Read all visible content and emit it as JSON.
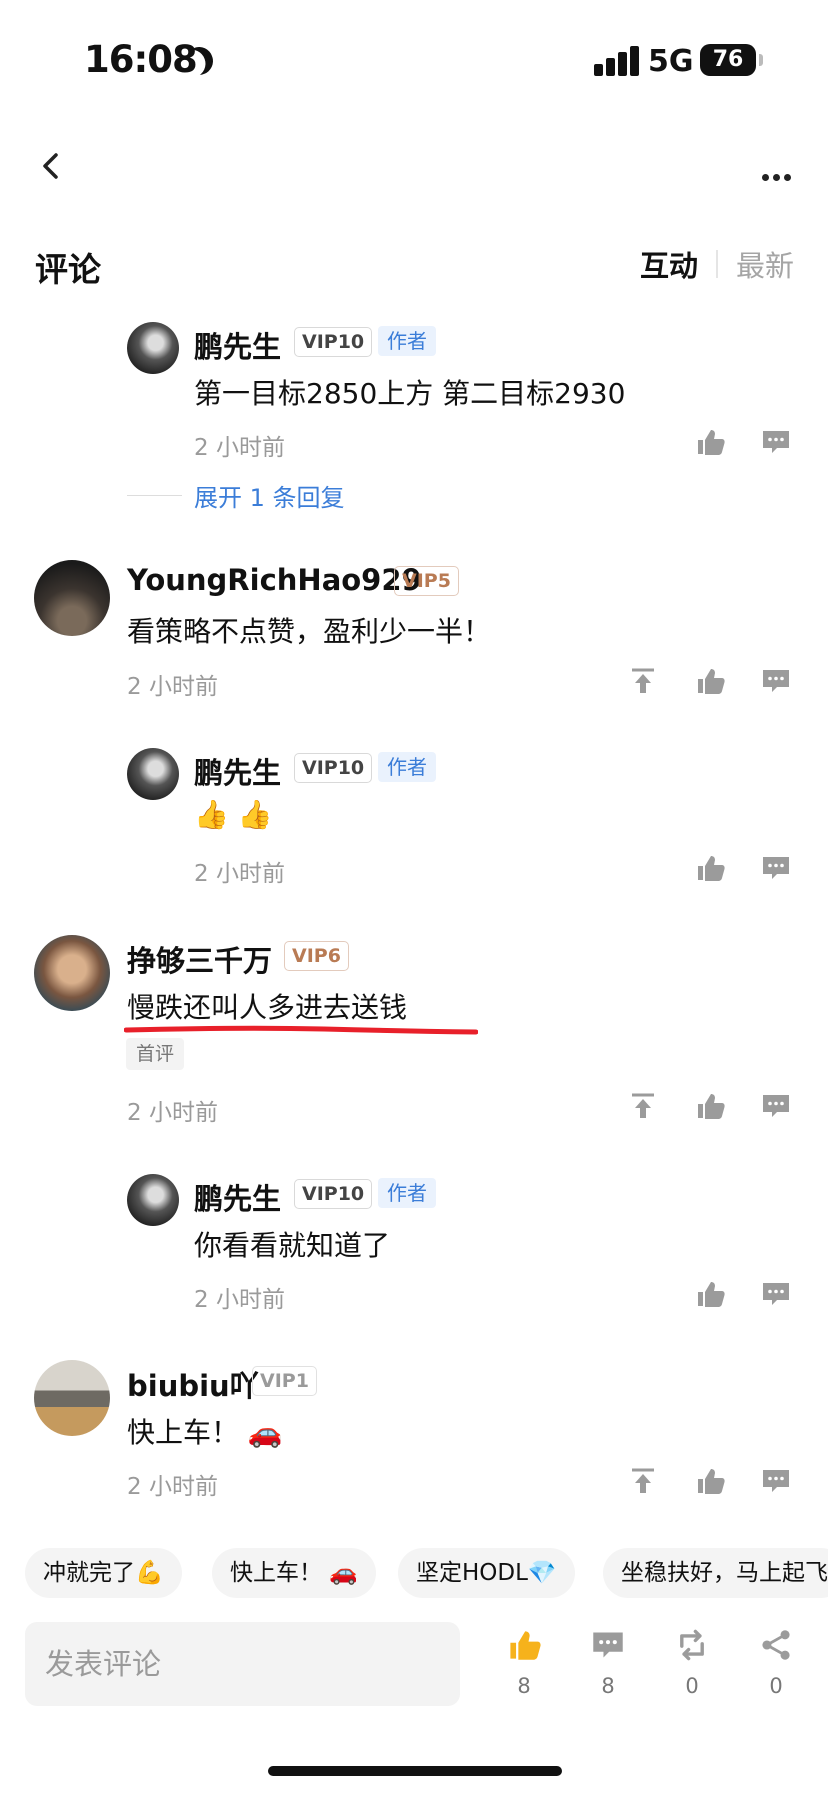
{
  "status_bar": {
    "time": "16:08",
    "network": "5G",
    "battery": "76"
  },
  "section": {
    "title": "评论"
  },
  "tabs": [
    {
      "label": "互动"
    },
    {
      "label": "最新"
    }
  ],
  "comments": [
    {
      "name": "鹏先生",
      "vip": "VIP10",
      "author": "作者",
      "text": "第一目标2850上方 第二目标2930",
      "time": "2 小时前",
      "expand": "展开 1 条回复"
    },
    {
      "name": "YoungRichHao929",
      "vip": "VIP5",
      "text": "看策略不点赞，盈利少一半！",
      "time": "2 小时前"
    },
    {
      "name": "鹏先生",
      "vip": "VIP10",
      "author": "作者",
      "text": "👍 👍",
      "time": "2 小时前"
    },
    {
      "name": "挣够三千万",
      "vip": "VIP6",
      "text": "慢跌还叫人多进去送钱",
      "badge": "首评",
      "time": "2 小时前"
    },
    {
      "name": "鹏先生",
      "vip": "VIP10",
      "author": "作者",
      "text": "你看看就知道了",
      "time": "2 小时前"
    },
    {
      "name": "biubiu吖",
      "vip": "VIP1",
      "text": "快上车！ 🚗",
      "time": "2 小时前"
    }
  ],
  "quick_replies": [
    "冲就完了💪",
    "快上车！ 🚗",
    "坚定HODL💎",
    "坐稳扶好，马上起飞"
  ],
  "bottom_bar": {
    "placeholder": "发表评论",
    "actions": [
      {
        "icon": "thumbs-up-icon",
        "count": "8"
      },
      {
        "icon": "comment-icon",
        "count": "8"
      },
      {
        "icon": "repost-icon",
        "count": "0"
      },
      {
        "icon": "share-icon",
        "count": "0"
      }
    ]
  }
}
